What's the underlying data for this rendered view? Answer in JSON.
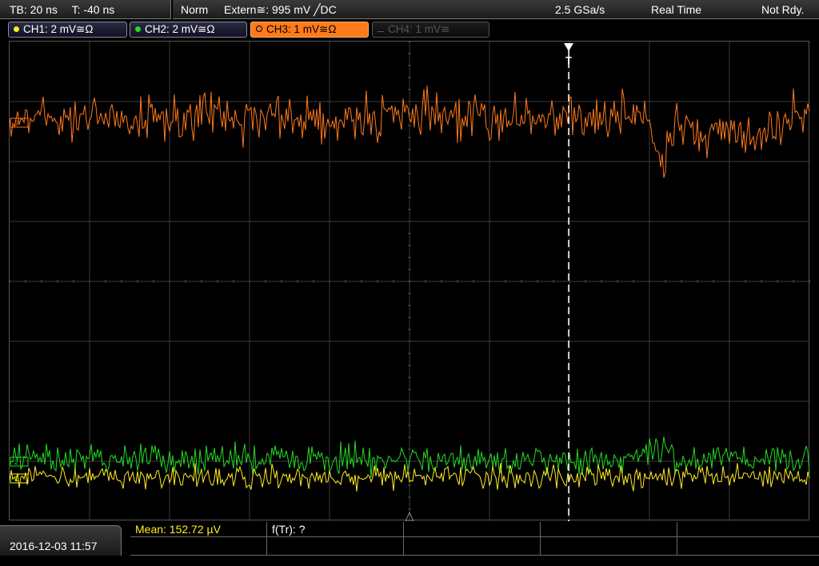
{
  "topbar": {
    "timebase": "TB: 20 ns",
    "trigger_time": "T: -40 ns",
    "mode": "Norm",
    "trigger_source": "Extern≅: 995 mV ╱DC",
    "sample_rate": "2.5 GSa/s",
    "acq_mode": "Real Time",
    "status": "Not Rdy."
  },
  "channels": [
    {
      "label": "CH1: 2 mV≅Ω",
      "color": "#ffee22",
      "state": "on"
    },
    {
      "label": "CH2: 2 mV≅Ω",
      "color": "#22dd22",
      "state": "on"
    },
    {
      "label": "CH3: 1 mV≅Ω",
      "color": "#ff7a1a",
      "state": "selected"
    },
    {
      "label": "CH4: 1 mV≅",
      "color": "#555555",
      "state": "off"
    }
  ],
  "screen": {
    "trigger_marker": "T",
    "channel_markers": [
      "1",
      "2",
      "3"
    ]
  },
  "bottombar": {
    "datetime": "2016-12-03 11:57",
    "mean": "Mean: 152.72 µV",
    "freq": "f(Tr): ?"
  },
  "colors": {
    "ch1": "#ffee22",
    "ch2": "#22dd22",
    "ch3": "#ff7a1a",
    "grid": "#3a3a3a"
  }
}
